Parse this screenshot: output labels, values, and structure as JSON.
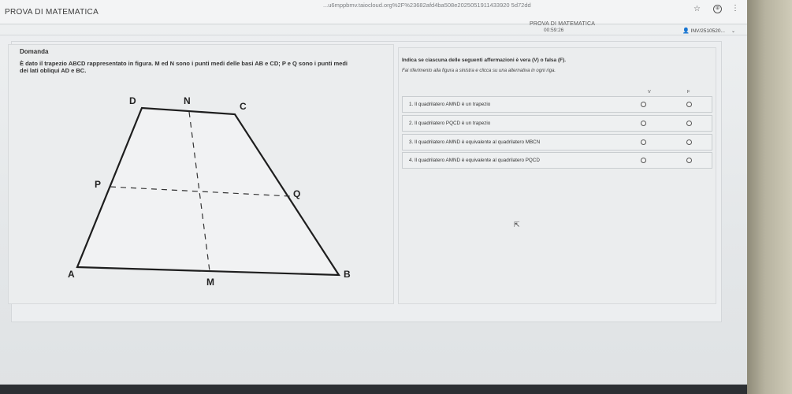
{
  "browser": {
    "url": "...u6mppbmv.taiocloud.org%2F%23682afd4ba508e2025051911433920 5d72dd",
    "app_title": "PROVA DI MATEMATICA",
    "icons": [
      "star-icon",
      "extension-icon",
      "menu-icon"
    ]
  },
  "header": {
    "exam_title": "PROVA DI MATEMATICA",
    "timer": "00:59:26",
    "user": "INV/2510520..."
  },
  "question": {
    "label": "Domanda",
    "text_line1": "È dato il trapezio ABCD rappresentato in figura. M ed N sono i punti medi delle basi AB e CD; P e Q sono i punti medi",
    "text_line2": "dei lati obliqui AD e BC."
  },
  "figure": {
    "points": {
      "A": "A",
      "B": "B",
      "C": "C",
      "D": "D",
      "M": "M",
      "N": "N",
      "P": "P",
      "Q": "Q"
    }
  },
  "statements": {
    "instruction": "Indica se ciascuna delle seguenti affermazioni è vera (V) o falsa (F).",
    "hint": "Fai riferimento alla figura a sinistra e clicca su una alternativa in ogni riga.",
    "col_true": "V",
    "col_false": "F",
    "items": [
      {
        "label": "1. Il quadrilatero AMND è un trapezio"
      },
      {
        "label": "2. Il quadrilatero PQCD è un trapezio"
      },
      {
        "label": "3. Il quadrilatero AMND è equivalente al quadrilatero MBCN"
      },
      {
        "label": "4. Il quadrilatero AMND è equivalente al quadrilatero PQCD"
      }
    ]
  },
  "colors": {
    "accent": "#333333",
    "panel": "#ebedee",
    "page": "#e4e7e9"
  }
}
